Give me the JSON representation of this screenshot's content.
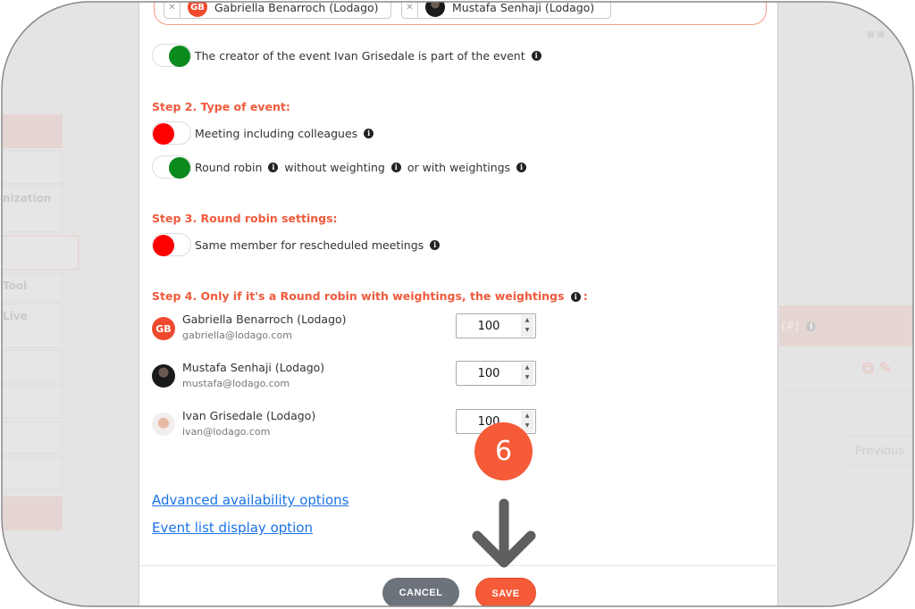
{
  "background": {
    "sidebar_items": [
      "",
      "",
      "nization",
      "",
      "Tool",
      "Live",
      "",
      "",
      "",
      "",
      ""
    ],
    "table_header": "(#)",
    "previous_button": "Previous"
  },
  "members_field": {
    "chips": [
      {
        "name": "Gabriella Benarroch (Lodago)",
        "initials": "GB"
      },
      {
        "name": "Mustafa Senhaji (Lodago)"
      }
    ]
  },
  "creator_toggle": {
    "label": "The creator of the event Ivan Grisedale is part of the event",
    "on": true
  },
  "step2": {
    "title": "Step 2. Type of event:",
    "meeting": {
      "label": "Meeting including colleagues",
      "on": false
    },
    "round_robin": {
      "label_a": "Round robin",
      "label_b": "without weighting",
      "label_c": "or with weightings",
      "on": true
    }
  },
  "step3": {
    "title": "Step 3. Round robin settings:",
    "same_member": {
      "label": "Same member for rescheduled meetings",
      "on": false
    }
  },
  "step4": {
    "title": "Step 4. Only if it's a Round robin with weightings, the weightings",
    "title_suffix": ":",
    "members": [
      {
        "name": "Gabriella Benarroch (Lodago)",
        "email": "gabriella@lodago.com",
        "initials": "GB",
        "weight": "100"
      },
      {
        "name": "Mustafa Senhaji (Lodago)",
        "email": "mustafa@lodago.com",
        "weight": "100"
      },
      {
        "name": "Ivan Grisedale (Lodago)",
        "email": "ivan@lodago.com",
        "weight": "100"
      }
    ]
  },
  "links": {
    "advanced": "Advanced availability options",
    "event_list": "Event list display option"
  },
  "footer": {
    "cancel": "CANCEL",
    "save": "SAVE"
  },
  "annotation": {
    "step_number": "6"
  },
  "colors": {
    "accent": "#f55b38",
    "toggle_on": "#0b8a1e",
    "toggle_off": "#ff0000",
    "link": "#1a73e8"
  }
}
